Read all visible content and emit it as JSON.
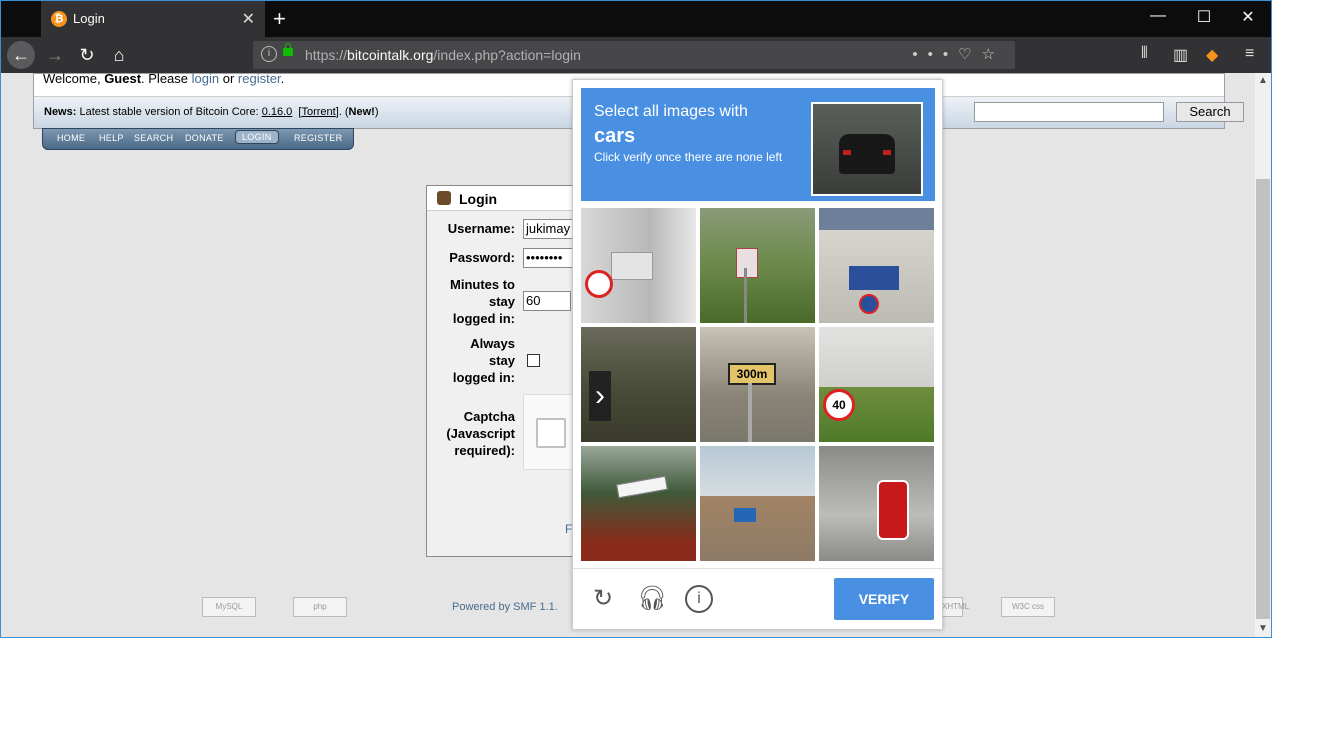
{
  "browser": {
    "tab_title": "Login",
    "tab_favicon": "bitcoin-icon",
    "url_prefix": "https://",
    "url_domain": "bitcointalk.org",
    "url_path": "/index.php?action=login",
    "accent": "#3c8fd4"
  },
  "forum": {
    "welcome_prefix": "Welcome,",
    "welcome_user": "Guest",
    "welcome_mid": ". Please",
    "login_link": "login",
    "or_text": "or",
    "register_link": "register",
    "news_label": "News:",
    "news_text": "Latest stable version of Bitcoin Core:",
    "news_version": "0.16.0",
    "news_torrent": "Torrent",
    "news_new": "New!",
    "search_button": "Search",
    "menu": [
      "HOME",
      "HELP",
      "SEARCH",
      "DONATE",
      "LOGIN",
      "REGISTER"
    ]
  },
  "login": {
    "title": "Login",
    "username_label": "Username:",
    "username_value": "jukimay",
    "password_label": "Password:",
    "password_value": "••••••••",
    "minutes_label_1": "Minutes to",
    "minutes_label_2": "stay",
    "minutes_label_3": "logged in:",
    "minutes_value": "60",
    "always_label_1": "Always",
    "always_label_2": "stay",
    "always_label_3": "logged in:",
    "captcha_label_1": "Captcha",
    "captcha_label_2": "(Javascript",
    "captcha_label_3": "required):",
    "forgot_partial": "Fo"
  },
  "footer": {
    "powered": "Powered by SMF 1.1.",
    "badges": [
      "MySQL",
      "php",
      "XHTML",
      "W3C css"
    ]
  },
  "captcha": {
    "line1": "Select all images with",
    "target": "cars",
    "line3": "Click verify once there are none left",
    "verify_button": "VERIFY",
    "reload_icon": "reload-icon",
    "audio_icon": "headphones-icon",
    "info_icon": "info-icon",
    "accent": "#4a90e2",
    "sample_scene": "rear of a dark car on a road"
  }
}
